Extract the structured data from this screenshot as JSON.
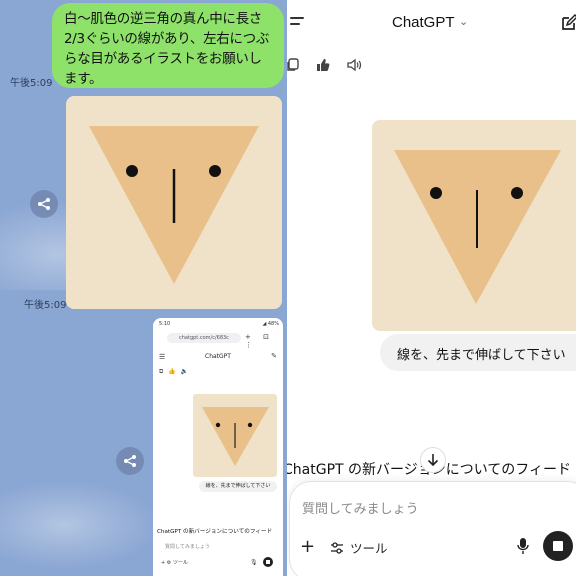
{
  "line_chat": {
    "message_text": "白〜肌色の逆三角の真ん中に長さ2/3ぐらいの線があり、左右につぶらな目があるイラストをお願いします。",
    "message_time": "午後5:09",
    "image_time": "午後5:09",
    "colors": {
      "background": "#8aa6d3",
      "bubble": "#8ee26a"
    }
  },
  "mini_screenshot": {
    "status_time": "5:10",
    "status_right": "◢ 48%",
    "url": "chatgpt.com/c/683c",
    "title": "ChatGPT",
    "request_text": "線を、先まで伸ばして下さい",
    "feedback_text": "ChatGPT の新バージョンについてのフィード",
    "input_placeholder": "質問してみましょう",
    "tools_label": "ツール"
  },
  "chatgpt": {
    "title": "ChatGPT",
    "request_text": "線を、先まで伸ばして下さい",
    "feedback_text": "ChatGPT の新バージョンについてのフィード",
    "input_placeholder": "質問してみましょう",
    "tools_label": "ツール",
    "colors": {
      "image_bg": "#efe2c8",
      "triangle": "#e9c08a"
    }
  }
}
